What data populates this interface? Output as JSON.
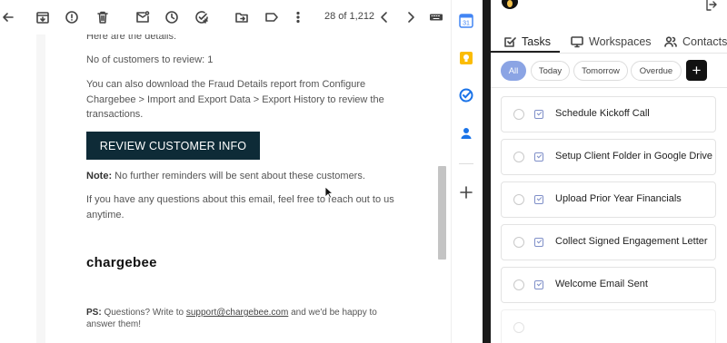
{
  "toolbar": {
    "pager_text": "28 of 1,212",
    "icons": [
      "back-arrow-icon",
      "archive-icon",
      "report-spam-icon",
      "delete-icon",
      "mark-unread-icon",
      "snooze-icon",
      "add-to-tasks-icon",
      "move-to-icon",
      "label-icon",
      "more-vert-icon",
      "newer-icon",
      "older-icon",
      "keyboard-icon"
    ]
  },
  "email": {
    "line_details": "Here are the details:",
    "line_customers": "No of customers to review: 1",
    "line_download": "You can also download the Fraud Details report from Configure Chargebee > Import and Export Data > Export History to review the transactions.",
    "button_label": "REVIEW CUSTOMER INFO",
    "note_label": "Note:",
    "note_text": " No further reminders will be sent about these customers.",
    "questions_text": "If you have any questions about this email, feel free to reach out to us anytime.",
    "brand": "chargebee",
    "ps_label": "PS:",
    "ps_text_before": " Questions? Write to ",
    "ps_link": "support@chargebee.com",
    "ps_text_after": " and we'd be happy to answer them!"
  },
  "app_strip": {
    "calendar_day": "31",
    "icons": [
      "calendar-icon",
      "keep-icon",
      "tasks-icon",
      "contacts-icon",
      "add-icon"
    ]
  },
  "panel": {
    "tabs": [
      {
        "label": "Tasks",
        "icon": "checkbox-icon",
        "active": true
      },
      {
        "label": "Workspaces",
        "icon": "monitor-icon",
        "active": false
      },
      {
        "label": "Contacts",
        "icon": "people-icon",
        "active": false
      }
    ],
    "filters": {
      "all": "All",
      "today": "Today",
      "tomorrow": "Tomorrow",
      "overdue": "Overdue",
      "add": "+"
    },
    "tasks": [
      {
        "label": "Schedule Kickoff Call"
      },
      {
        "label": "Setup Client Folder in Google Drive"
      },
      {
        "label": "Upload Prior Year Financials"
      },
      {
        "label": "Collect Signed Engagement Letter"
      },
      {
        "label": "Welcome Email Sent"
      }
    ],
    "colors": {
      "active_chip": "#8ba4e4",
      "add_button": "#111111",
      "divider": "#1a1a1a"
    }
  },
  "colors": {
    "review_button": "#0e2b37",
    "scrollbar_thumb": "#c4c4c4"
  }
}
